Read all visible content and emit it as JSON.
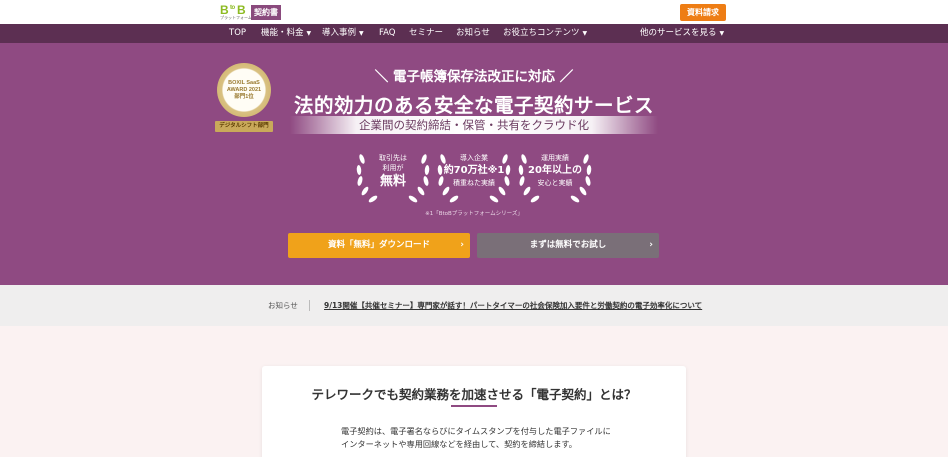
{
  "header": {
    "logo_btob_b1": "B",
    "logo_btob_to": "to",
    "logo_btob_b2": "B",
    "logo_btob_sub": "プラットフォーム",
    "logo_badge": "契約書",
    "request_button": "資料請求"
  },
  "nav": {
    "items": [
      "TOP",
      "機能・料金",
      "導入事例",
      "FAQ",
      "セミナー",
      "お知らせ",
      "お役立ちコンテンツ"
    ],
    "other_services": "他のサービスを見る"
  },
  "hero": {
    "award_line1": "BOXIL SaaS",
    "award_line2": "AWARD 2021",
    "award_line3": "部門1位",
    "award_ribbon": "デジタルシフト部門",
    "catch": "＼ 電子帳簿保存法改正に対応 ／",
    "headline": "法的効力のある安全な電子契約サービス",
    "subheadline": "企業間の契約締結・保管・共有をクラウド化",
    "laurels": [
      {
        "top": "取引先は",
        "mid": "利用が",
        "big": "無料",
        "bottom": ""
      },
      {
        "top": "導入企業",
        "mid": "約70万社※1",
        "big": "",
        "bottom": "積重ねた実績"
      },
      {
        "top": "運用実績",
        "mid": "20年以上の",
        "big": "",
        "bottom": "安心と実績"
      }
    ],
    "footnote": "※1「BtoBプラットフォームシリーズ」",
    "cta_download": "資料「無料」ダウンロード",
    "cta_trial": "まずは無料でお試し"
  },
  "news": {
    "label": "お知らせ",
    "link": "9/13開催【共催セミナー】専門家が話す！パートタイマーの社会保険加入要件と労働契約の電子効率化について"
  },
  "intro": {
    "title": "テレワークでも契約業務を加速させる「電子契約」とは？",
    "body_line1": "電子契約は、電子署名ならびにタイムスタンプを付与した電子ファイルに",
    "body_line2": "インターネットや専用回線などを経由して、契約を締結します。"
  }
}
